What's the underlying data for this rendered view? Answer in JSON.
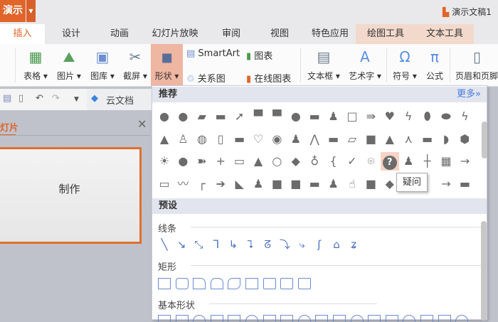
{
  "app": {
    "menu_label": "演示",
    "doc_title": "演示文稿1"
  },
  "tabs": [
    "插入",
    "设计",
    "动画",
    "幻灯片放映",
    "审阅",
    "视图",
    "特色应用",
    "绘图工具",
    "文本工具"
  ],
  "ribbon": {
    "big": [
      {
        "label": "表格 ▾",
        "icon": "table-icon"
      },
      {
        "label": "图片 ▾",
        "icon": "picture-icon"
      },
      {
        "label": "图库 ▾",
        "icon": "gallery-icon"
      },
      {
        "label": "截屏 ▾",
        "icon": "screenshot-icon"
      },
      {
        "label": "形状 ▾",
        "icon": "shapes-icon"
      },
      {
        "label": "文本框 ▾",
        "icon": "textbox-icon"
      },
      {
        "label": "艺术字 ▾",
        "icon": "wordart-icon"
      },
      {
        "label": "符号 ▾",
        "icon": "omega-icon"
      },
      {
        "label": "公式",
        "icon": "pi-icon"
      },
      {
        "label": "页眉和页脚",
        "icon": "header-footer-icon"
      }
    ],
    "smartart": "SmartArt",
    "chart": "图表",
    "relation": "关系图",
    "online_chart": "在线图表"
  },
  "quickbar": {
    "cloud": "云文档"
  },
  "pane": {
    "tab": "灯片",
    "slide_text": "制作"
  },
  "shapes_panel": {
    "recommended": "推荐",
    "more": "更多»",
    "presets": "预设",
    "lines": "线条",
    "rectangles": "矩形",
    "basic": "基本形状",
    "tooltip": "疑问",
    "selected_shape": "question-bubble",
    "recommended_glyphs": [
      [
        "●",
        "●",
        "▰",
        "▬",
        "➚",
        "▀",
        "▀",
        "●",
        "▬",
        "♟",
        "□",
        "⇛",
        "♥",
        "ϟ",
        "⬮",
        "⬬",
        "ϟ"
      ],
      [
        "▲",
        "♙",
        "◍",
        "▯",
        "▬",
        "♡",
        "◉",
        "♟",
        "⋀",
        "▬",
        "▱",
        "■",
        "▲",
        "⋏",
        "▬",
        "◗",
        "⬢"
      ],
      [
        "☀",
        "●",
        "➽",
        "+",
        "▭",
        "▲",
        "○",
        "◆",
        "♁",
        "{",
        "✓",
        "⌾",
        "?",
        "♟",
        "┼",
        "▦",
        "→"
      ],
      [
        "▭",
        "〰",
        "┌",
        "➔",
        "◣",
        "♟",
        "■",
        "■",
        "▬",
        "♟",
        "☝",
        "■",
        "◆",
        "",
        "",
        "→",
        "▬"
      ]
    ],
    "line_glyphs": [
      "╲",
      "↘",
      "⤡",
      "ᒣ",
      "↳",
      "⮧",
      "ᘔ",
      "⤵",
      "⤷",
      "ʃ",
      "⌂",
      "ʑ"
    ],
    "accent": "#e0652a"
  }
}
